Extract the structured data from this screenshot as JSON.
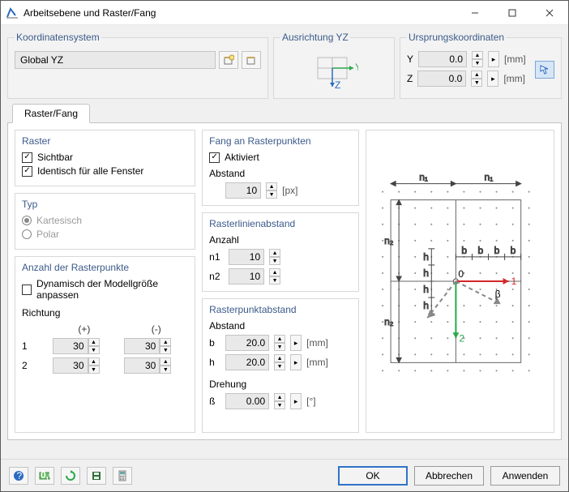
{
  "window": {
    "title": "Arbeitsebene und Raster/Fang"
  },
  "coord": {
    "legend": "Koordinatensystem",
    "value": "Global YZ"
  },
  "orient": {
    "legend": "Ausrichtung YZ"
  },
  "origin": {
    "legend": "Ursprungskoordinaten",
    "rows": [
      {
        "axis": "Y",
        "value": "0.0",
        "unit": "[mm]"
      },
      {
        "axis": "Z",
        "value": "0.0",
        "unit": "[mm]"
      }
    ]
  },
  "tab": {
    "label": "Raster/Fang"
  },
  "raster": {
    "legend": "Raster",
    "visible": "Sichtbar",
    "identical": "Identisch für alle Fenster"
  },
  "typ": {
    "legend": "Typ",
    "kart": "Kartesisch",
    "polar": "Polar"
  },
  "anzahl": {
    "legend": "Anzahl der Rasterpunkte",
    "dyn": "Dynamisch der Modellgröße anpassen",
    "direction": "Richtung",
    "plus": "(+)",
    "minus": "(-)",
    "r1": {
      "i": "1",
      "p": "30",
      "m": "30"
    },
    "r2": {
      "i": "2",
      "p": "30",
      "m": "30"
    }
  },
  "fang": {
    "legend": "Fang an Rasterpunkten",
    "aktiv": "Aktiviert",
    "abstand": "Abstand",
    "value": "10",
    "unit": "[px]"
  },
  "rla": {
    "legend": "Rasterlinienabstand",
    "anzahl": "Anzahl",
    "n1": {
      "l": "n1",
      "v": "10"
    },
    "n2": {
      "l": "n2",
      "v": "10"
    }
  },
  "rpa": {
    "legend": "Rasterpunktabstand",
    "abstand": "Abstand",
    "b": {
      "l": "b",
      "v": "20.0",
      "u": "[mm]"
    },
    "h": {
      "l": "h",
      "v": "20.0",
      "u": "[mm]"
    },
    "drehung": "Drehung",
    "beta": {
      "l": "ß",
      "v": "0.00",
      "u": "[°]"
    }
  },
  "buttons": {
    "ok": "OK",
    "cancel": "Abbrechen",
    "apply": "Anwenden"
  }
}
